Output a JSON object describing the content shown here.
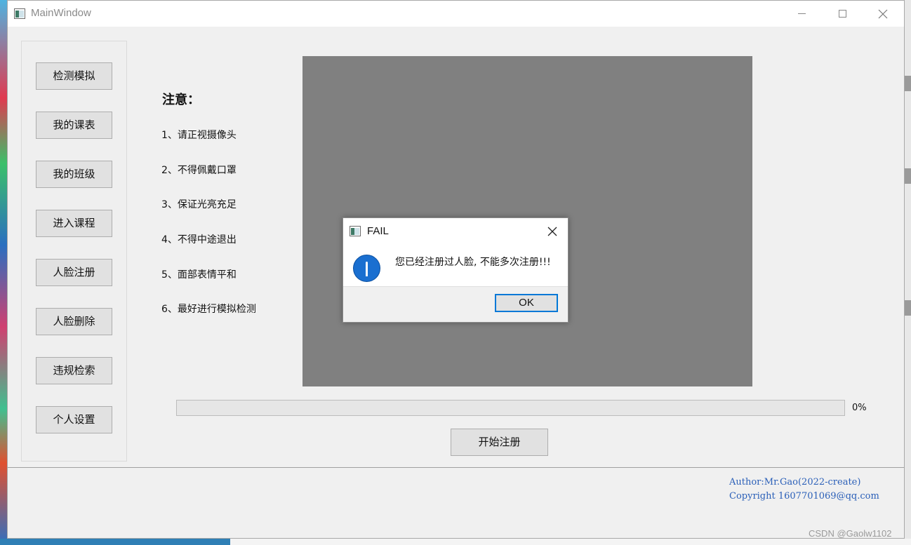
{
  "window": {
    "title": "MainWindow"
  },
  "sidebar": {
    "items": [
      {
        "label": "检测模拟"
      },
      {
        "label": "我的课表"
      },
      {
        "label": "我的班级"
      },
      {
        "label": "进入课程"
      },
      {
        "label": "人脸注册"
      },
      {
        "label": "人脸删除"
      },
      {
        "label": "违规检索"
      },
      {
        "label": "个人设置"
      }
    ]
  },
  "notes": {
    "title": "注意：",
    "items": [
      "1、请正视摄像头",
      "2、不得佩戴口罩",
      "3、保证光亮充足",
      "4、不得中途退出",
      "5、面部表情平和",
      "6、最好进行模拟检测"
    ]
  },
  "progress": {
    "value": 0,
    "text": "0%"
  },
  "start_button": {
    "label": "开始注册"
  },
  "footer": {
    "author": "Author:Mr.Gao(2022-create)",
    "copyright": "Copyright 1607701069@qq.com"
  },
  "dialog": {
    "title": "FAIL",
    "message": "您已经注册过人脸, 不能多次注册!!!",
    "ok_label": "OK"
  },
  "watermark": "CSDN @Gaolw1102",
  "colors": {
    "preview": "#808080",
    "credit_text": "#2a5fb8",
    "info_icon": "#1a6fd0",
    "focus_border": "#0078d7"
  }
}
